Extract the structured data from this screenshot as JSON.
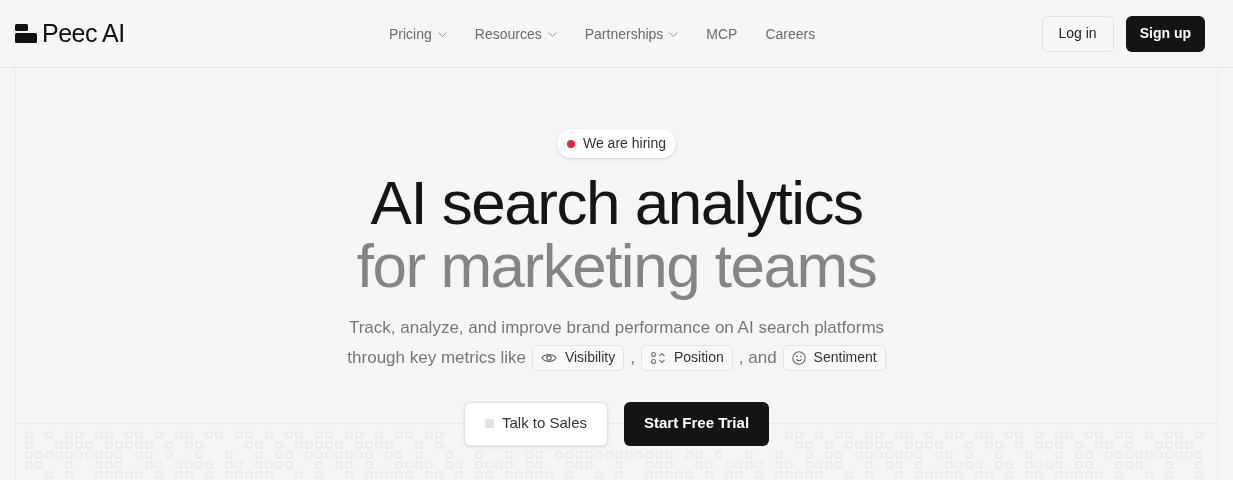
{
  "logo": {
    "text": "Peec AI"
  },
  "nav": [
    {
      "label": "Pricing",
      "dropdown": true
    },
    {
      "label": "Resources",
      "dropdown": true
    },
    {
      "label": "Partnerships",
      "dropdown": true
    },
    {
      "label": "MCP",
      "dropdown": false
    },
    {
      "label": "Careers",
      "dropdown": false
    }
  ],
  "auth": {
    "login": "Log in",
    "signup": "Sign up"
  },
  "badge": {
    "text": "We are hiring",
    "color": "#e0294a"
  },
  "headline": [
    "AI search analytics",
    "for marketing teams"
  ],
  "subtitle": {
    "line1": "Track, analyze, and improve brand performance on AI search platforms",
    "parts": [
      {
        "kind": "text",
        "text": "through key metrics like"
      },
      {
        "kind": "chip",
        "text": "Visibility"
      },
      {
        "kind": "text",
        "text": ","
      },
      {
        "kind": "chip",
        "text": "Position"
      },
      {
        "kind": "text",
        "text": ", and"
      },
      {
        "kind": "chip",
        "text": "Sentiment"
      }
    ]
  },
  "ctas": [
    {
      "label": "Talk to Sales",
      "primary": false
    },
    {
      "label": "Start Free Trial",
      "primary": true
    }
  ]
}
